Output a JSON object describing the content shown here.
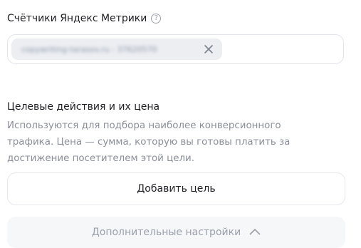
{
  "metrika": {
    "title": "Счётчики Яндекс Метрики",
    "help_icon": "question-circle-icon",
    "counter_chip_text": "copywriting-tarasov.ru - 37620570",
    "remove_icon": "close-icon"
  },
  "goals": {
    "title": "Целевые действия и их цена",
    "description": "Используются для подбора наиболее конверсионного трафика. Цена — сумма, которую вы готовы платить за достижение посетителем этой цели.",
    "add_button_label": "Добавить цель"
  },
  "advanced": {
    "label": "Дополнительные настройки",
    "icon": "chevron-up-icon"
  }
}
